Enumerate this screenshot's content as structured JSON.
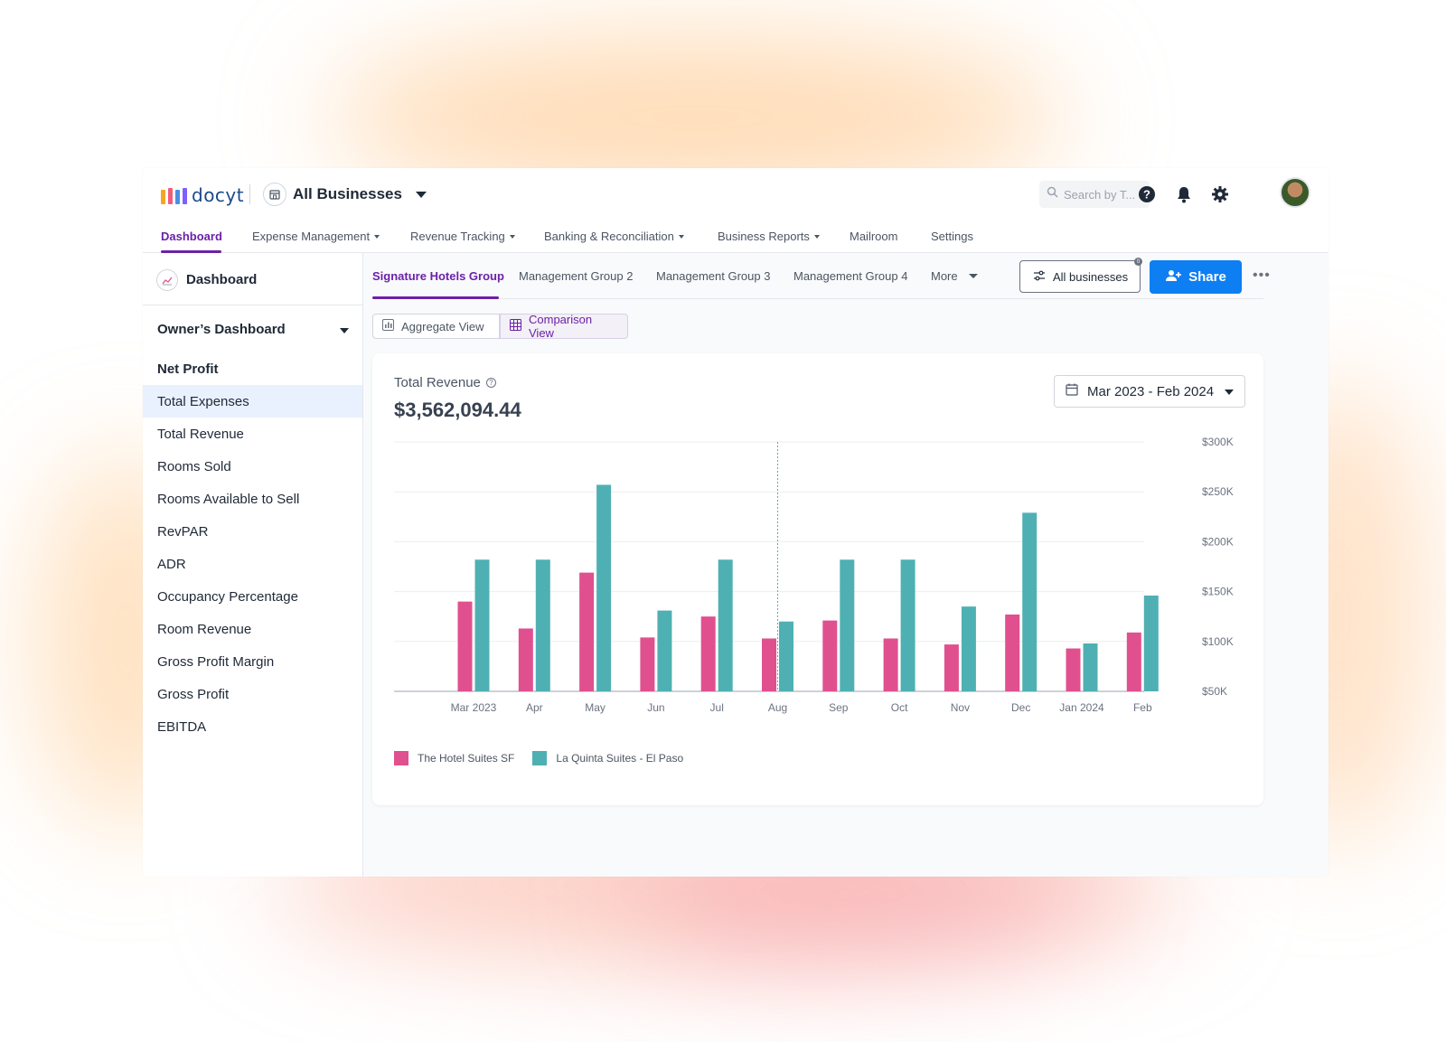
{
  "app": {
    "logo_text": "docyt",
    "business_selector": "All Businesses"
  },
  "search": {
    "placeholder": "Search by T..."
  },
  "icons": {
    "help": "help-circle-icon",
    "notifications": "bell-icon",
    "settings": "gear-icon",
    "business": "storefront-icon",
    "search": "search-icon"
  },
  "nav": {
    "items": [
      {
        "label": "Dashboard",
        "has_menu": false
      },
      {
        "label": "Expense Management",
        "has_menu": true
      },
      {
        "label": "Revenue Tracking",
        "has_menu": true
      },
      {
        "label": "Banking & Reconciliation",
        "has_menu": true
      },
      {
        "label": "Business Reports",
        "has_menu": true
      },
      {
        "label": "Mailroom",
        "has_menu": false
      },
      {
        "label": "Settings",
        "has_menu": false
      }
    ],
    "active": "Dashboard"
  },
  "sidebar": {
    "title": "Dashboard",
    "group": "Owner’s Dashboard",
    "items": [
      {
        "label": "Net Profit"
      },
      {
        "label": "Total Expenses"
      },
      {
        "label": "Total Revenue"
      },
      {
        "label": "Rooms Sold"
      },
      {
        "label": "Rooms Available to Sell"
      },
      {
        "label": "RevPAR"
      },
      {
        "label": "ADR"
      },
      {
        "label": "Occupancy Percentage"
      },
      {
        "label": "Room Revenue"
      },
      {
        "label": "Gross Profit Margin"
      },
      {
        "label": "Gross Profit"
      },
      {
        "label": "EBITDA"
      }
    ],
    "selected": "Total Expenses"
  },
  "group_tabs": {
    "items": [
      "Signature Hotels Group",
      "Management Group 2",
      "Management Group 3",
      "Management Group 4"
    ],
    "more": "More",
    "active": "Signature Hotels Group"
  },
  "toolbar": {
    "filter_label": "All businesses",
    "filter_badge": "0",
    "share_label": "Share",
    "more_label": "•••"
  },
  "views": {
    "aggregate": "Aggregate View",
    "comparison": "Comparison View",
    "active": "Comparison View"
  },
  "card": {
    "title": "Total Revenue",
    "value": "$3,562,094.44",
    "date_range": "Mar 2023 - Feb 2024"
  },
  "colors": {
    "accent": "#6b21a8",
    "primary": "#0d7ff2",
    "series_1": "#e0508f",
    "series_2": "#4fb0b4"
  },
  "chart_data": {
    "type": "bar",
    "categories": [
      "Mar 2023",
      "Apr",
      "May",
      "Jun",
      "Jul",
      "Aug",
      "Sep",
      "Oct",
      "Nov",
      "Dec",
      "Jan 2024",
      "Feb"
    ],
    "series": [
      {
        "name": "The Hotel Suites SF",
        "color": "#e0508f",
        "values": [
          140000,
          113000,
          169000,
          104000,
          125000,
          103000,
          121000,
          103000,
          97000,
          127000,
          93000,
          109000
        ]
      },
      {
        "name": "La Quinta Suites - El Paso",
        "color": "#4fb0b4",
        "values": [
          182000,
          182000,
          257000,
          131000,
          182000,
          120000,
          182000,
          182000,
          135000,
          229000,
          98000,
          146000
        ]
      }
    ],
    "y_ticks": [
      "$300K",
      "$250K",
      "$200K",
      "$150K",
      "$100K",
      "$50K"
    ],
    "ylim": [
      50000,
      300000
    ],
    "y_axis_side": "right",
    "grid": true,
    "hover_marker_category": "Aug",
    "legend_position": "bottom-left"
  }
}
